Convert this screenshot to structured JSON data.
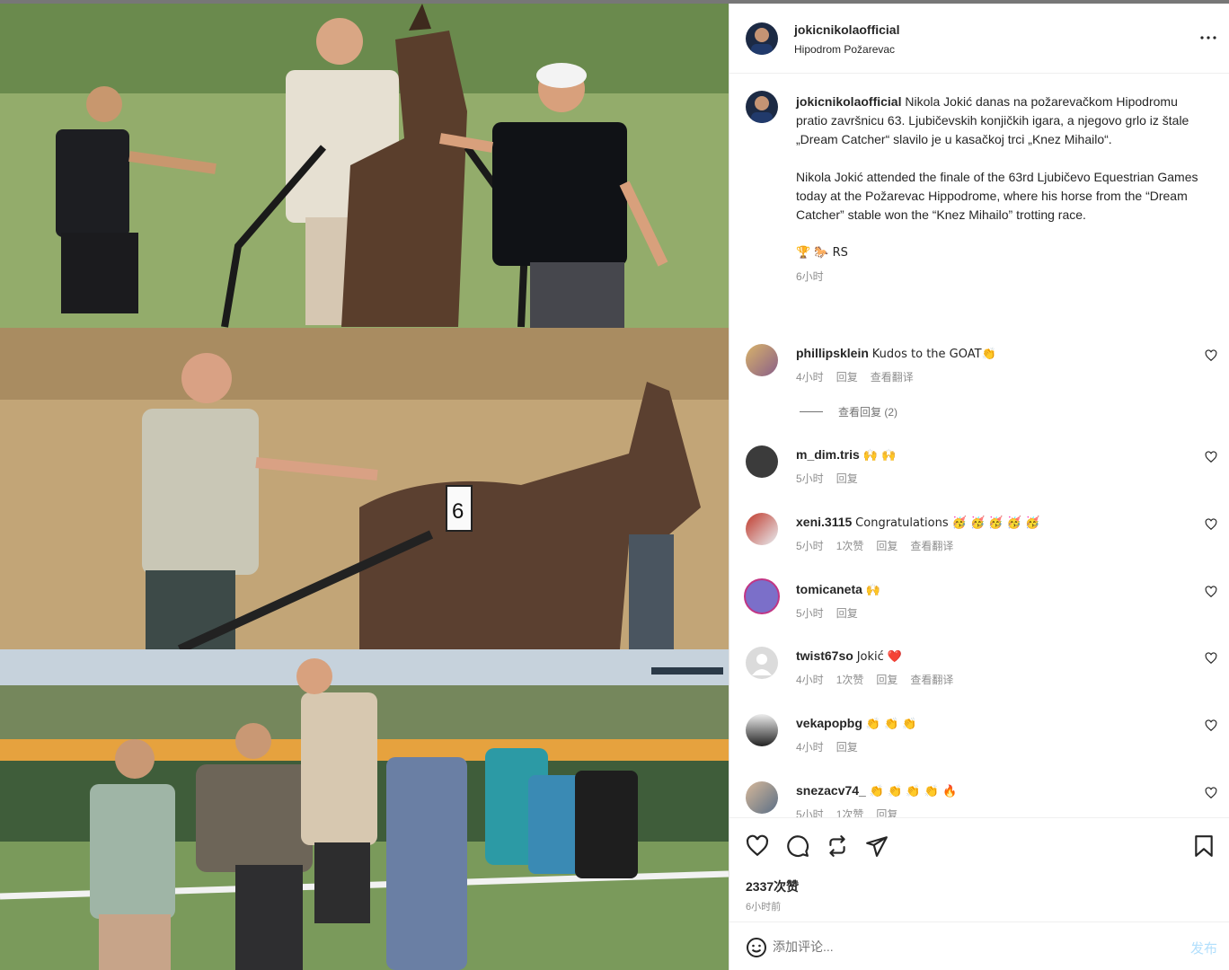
{
  "post": {
    "username": "jokicnikolaofficial",
    "location": "Hipodrom Požarevac",
    "caption_serbian": "Nikola Jokić danas na požarevačkom Hipodromu pratio završnicu 63. Ljubičevskih konjičkih igara, a njegovo grlo iz štale „Dream Catcher“ slavilo je u kasačkoj trci „Knez Mihailo“.",
    "caption_english": "Nikola Jokić attended the finale of the 63rd Ljubičevo Equestrian Games today at the Požarevac Hippodrome, where his horse from the “Dream Catcher” stable won the “Knez Mihailo” trotting race.",
    "caption_emoji": "🏆 🐎 RS",
    "caption_time": "6小时",
    "likes": "2337次赞",
    "time_ago": "6小时前",
    "comment_placeholder": "添加评论...",
    "post_label": "发布"
  },
  "comments": [
    {
      "user": "phillipsklein",
      "text": "Kudos to the GOAT👏",
      "time": "4小时",
      "likes": "",
      "reply": "回复",
      "translate": "查看翻译"
    },
    {
      "user": "m_dim.tris",
      "text": "🙌 🙌",
      "time": "5小时",
      "likes": "",
      "reply": "回复",
      "translate": ""
    },
    {
      "user": "xeni.3115",
      "text": "Congratulations 🥳 🥳 🥳 🥳 🥳",
      "time": "5小时",
      "likes": "1次赞",
      "reply": "回复",
      "translate": "查看翻译"
    },
    {
      "user": "tomicaneta",
      "text": "🙌",
      "time": "5小时",
      "likes": "",
      "reply": "回复",
      "translate": ""
    },
    {
      "user": "twist67so",
      "text": "Jokić ❤️",
      "time": "4小时",
      "likes": "1次赞",
      "reply": "回复",
      "translate": "查看翻译"
    },
    {
      "user": "vekapopbg",
      "text": "👏 👏 👏",
      "time": "4小时",
      "likes": "",
      "reply": "回复",
      "translate": ""
    },
    {
      "user": "snezacv74_",
      "text": "👏 👏 👏 👏 🔥",
      "time": "5小时",
      "likes": "1次赞",
      "reply": "回复",
      "translate": ""
    }
  ],
  "view_replies": "查看回复 (2)",
  "colors": {
    "accent": "#0095f6",
    "muted": "#8e8e8e",
    "text": "#262626",
    "heart": "#ed4956"
  }
}
